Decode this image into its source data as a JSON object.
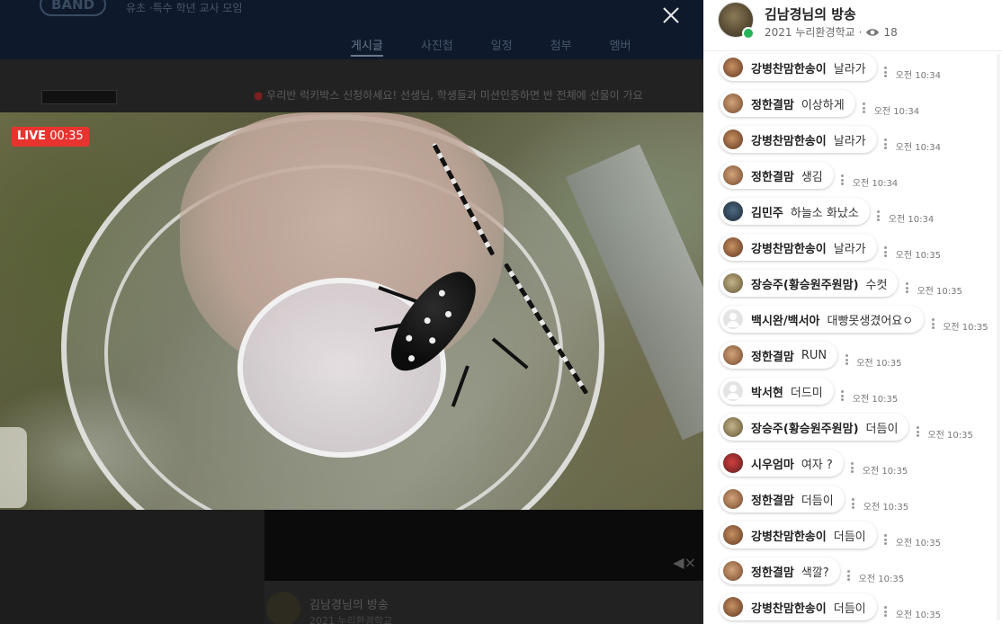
{
  "background": {
    "band_logo": "BAND",
    "band_name": "유초 ·특수 학년 교사 모임",
    "nav_tabs": [
      "게시글",
      "사진첩",
      "일정",
      "첨부",
      "멤버"
    ],
    "notice": "우리반 럭키박스 신청하세요! 선생님, 학생들과 미션인증하면 반 전체에 선물이 가요",
    "post_title": "김남경님의 방송",
    "post_sub": "2021 누리환경학교"
  },
  "live": {
    "badge_label": "LIVE",
    "elapsed": "00:35"
  },
  "broadcast": {
    "host_name": "김남경님의 방송",
    "band_name": "2021 누리환경학교",
    "separator": "·",
    "viewer_count": "18"
  },
  "chat": {
    "messages": [
      {
        "nick": "강병찬맘한송이",
        "text": "날라가",
        "time": "오전 10:34",
        "avatar": "a"
      },
      {
        "nick": "정한결맘",
        "text": "이상하게",
        "time": "오전 10:34",
        "avatar": "b"
      },
      {
        "nick": "강병찬맘한송이",
        "text": "날라가",
        "time": "오전 10:34",
        "avatar": "a"
      },
      {
        "nick": "정한결맘",
        "text": "생김",
        "time": "오전 10:34",
        "avatar": "b"
      },
      {
        "nick": "김민주",
        "text": "하늘소 화났소",
        "time": "오전 10:34",
        "avatar": "c"
      },
      {
        "nick": "강병찬맘한송이",
        "text": "날라가",
        "time": "오전 10:35",
        "avatar": "a"
      },
      {
        "nick": "장승주(황승원주원맘)",
        "text": "수컷",
        "time": "오전 10:35",
        "avatar": "d"
      },
      {
        "nick": "백시완/백서아",
        "text": "대빵못생겼어요ㅇ",
        "time": "오전 10:35",
        "avatar": "e"
      },
      {
        "nick": "정한결맘",
        "text": "RUN",
        "time": "오전 10:35",
        "avatar": "b"
      },
      {
        "nick": "박서현",
        "text": "더드미",
        "time": "오전 10:35",
        "avatar": "e"
      },
      {
        "nick": "장승주(황승원주원맘)",
        "text": "더듬이",
        "time": "오전 10:35",
        "avatar": "d"
      },
      {
        "nick": "시우엄마",
        "text": "여자 ?",
        "time": "오전 10:35",
        "avatar": "f"
      },
      {
        "nick": "정한결맘",
        "text": "더듬이",
        "time": "오전 10:35",
        "avatar": "b"
      },
      {
        "nick": "강병찬맘한송이",
        "text": "더듬이",
        "time": "오전 10:35",
        "avatar": "a"
      },
      {
        "nick": "정한결맘",
        "text": "색깔?",
        "time": "오전 10:35",
        "avatar": "b"
      },
      {
        "nick": "강병찬맘한송이",
        "text": "더듬이",
        "time": "오전 10:35",
        "avatar": "a"
      }
    ]
  },
  "icons": {
    "close": "close-icon",
    "viewers": "eye-icon",
    "more": "more-vertical-icon",
    "mute": "mute-icon"
  }
}
